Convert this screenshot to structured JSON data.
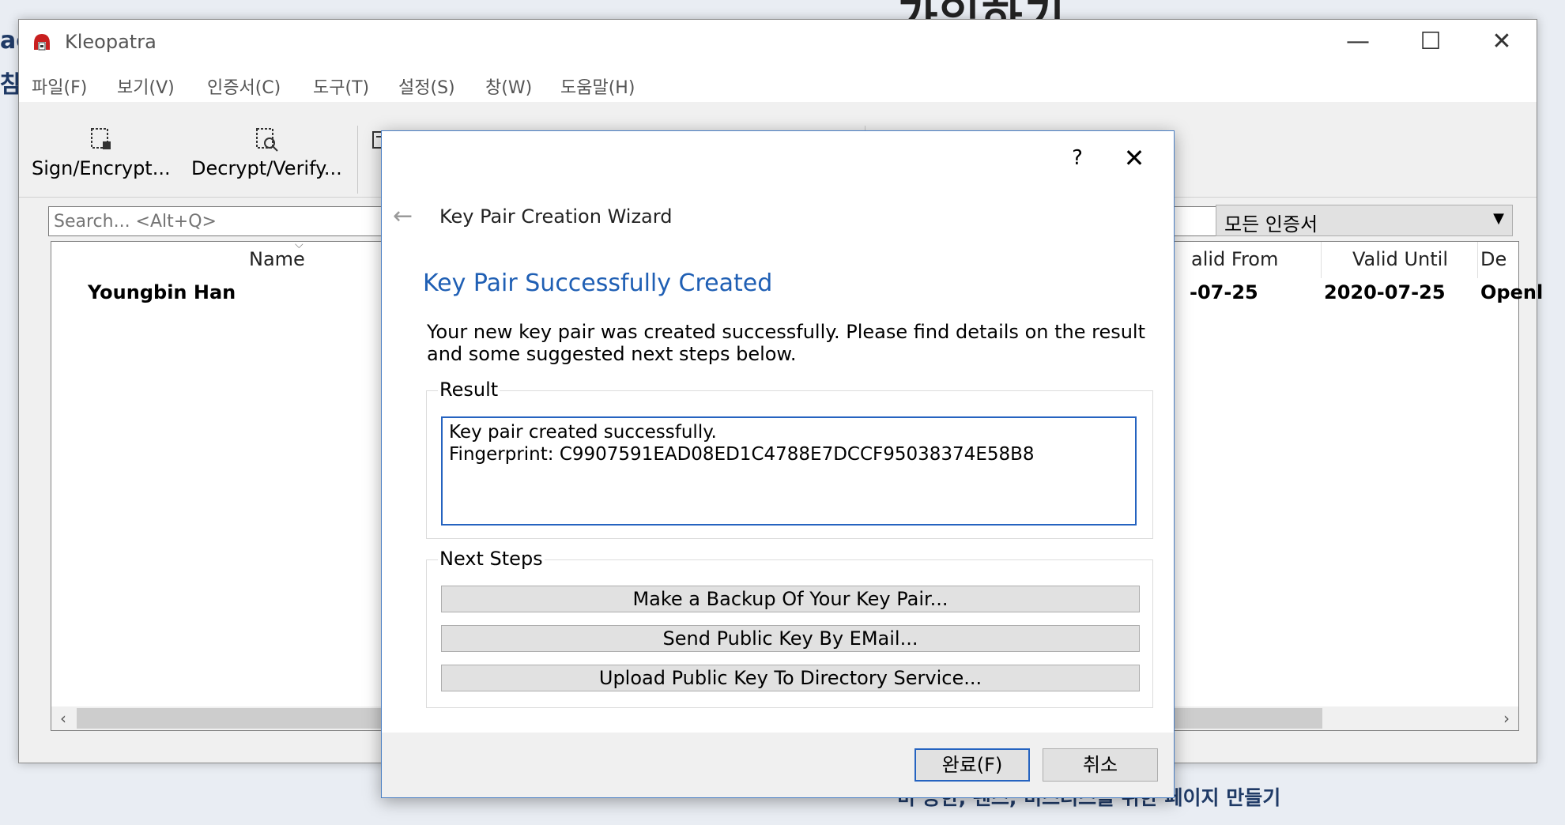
{
  "background": {
    "title": "가입하기",
    "side_text_1": "ac",
    "side_text_2": "참기",
    "footer_text": "비 공한, 팬스, 미스터스를 위한 페이지 만들기"
  },
  "window": {
    "title": "Kleopatra",
    "controls": {
      "minimize": "—",
      "maximize": "☐",
      "close": "✕"
    }
  },
  "menu": [
    "파일(F)",
    "보기(V)",
    "인증서(C)",
    "도구(T)",
    "설정(S)",
    "창(W)",
    "도움말(H)"
  ],
  "toolbar": {
    "sign_encrypt": "Sign/Encrypt...",
    "decrypt_verify": "Decrypt/Verify...",
    "import_partial": "I"
  },
  "search": {
    "placeholder": "Search... <Alt+Q>"
  },
  "filter": {
    "selected": "모든 인증서"
  },
  "cert_list": {
    "columns": {
      "name": "Name",
      "valid_from": "alid From",
      "valid_until": "Valid Until",
      "details": "De"
    },
    "rows": [
      {
        "name": "Youngbin Han",
        "valid_from": "-07-25",
        "valid_until": "2020-07-25",
        "details": "Openl"
      }
    ]
  },
  "dialog": {
    "help": "?",
    "close": "✕",
    "back": "←",
    "title": "Key Pair Creation Wizard",
    "heading": "Key Pair Successfully Created",
    "description": "Your new key pair was created successfully. Please find details on the result and some suggested next steps below.",
    "result_group": "Result",
    "result_line1": "Key pair created successfully.",
    "result_line2": "Fingerprint: C9907591EAD08ED1C4788E7DCCF95038374E58B8",
    "next_steps_group": "Next Steps",
    "steps": [
      "Make a Backup Of Your Key Pair...",
      "Send Public Key By EMail...",
      "Upload Public Key To Directory Service..."
    ],
    "finish": "완료(F)",
    "cancel": "취소"
  }
}
